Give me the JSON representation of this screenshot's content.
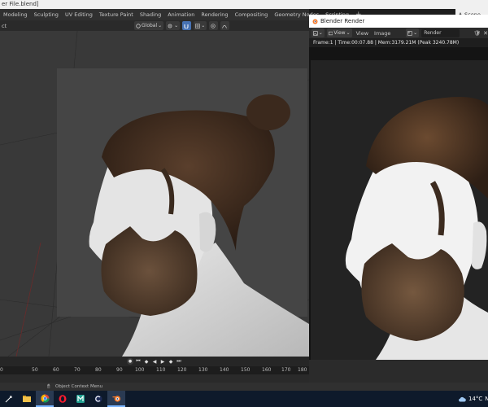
{
  "window": {
    "title": "er File.blend]"
  },
  "workspace_tabs": [
    {
      "label": "Modeling"
    },
    {
      "label": "Sculpting"
    },
    {
      "label": "UV Editing"
    },
    {
      "label": "Texture Paint"
    },
    {
      "label": "Shading"
    },
    {
      "label": "Animation"
    },
    {
      "label": "Rendering"
    },
    {
      "label": "Compositing"
    },
    {
      "label": "Geometry Nodes"
    },
    {
      "label": "Scripting"
    }
  ],
  "add_workspace": "+",
  "scene": {
    "label": "Scene"
  },
  "viewport_header": {
    "mode_label": "ct",
    "orientation": "Global"
  },
  "render_window": {
    "title": "Blender Render",
    "menu": [
      "View",
      "View",
      "Image"
    ],
    "slot": "Render Result",
    "info": "Frame:1 | Time:00:07.88 | Mem:3179.21M (Peak 3240.78M)"
  },
  "timeline": {
    "ticks": [
      "0",
      "50",
      "60",
      "70",
      "80",
      "90",
      "100",
      "110",
      "120",
      "130",
      "140",
      "150",
      "160",
      "170",
      "180"
    ]
  },
  "statusbar": {
    "text": "Object Context Menu"
  },
  "taskbar": {
    "tray_temp": "14°C",
    "tray_extra": "N"
  },
  "colors": {
    "accent": "#4772b3",
    "viewport_bg": "#393939",
    "taskbar_bg": "#0e1a2b"
  }
}
